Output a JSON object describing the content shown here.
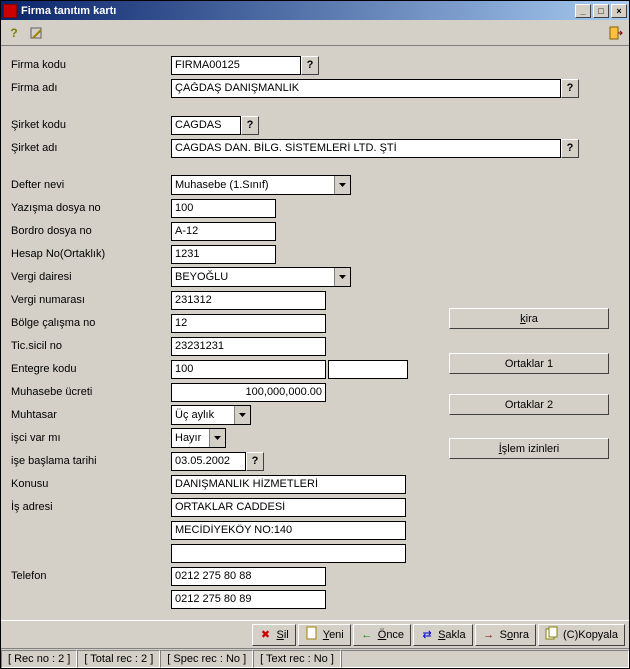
{
  "window": {
    "title": "Firma tanıtım kartı"
  },
  "labels": {
    "firma_kodu": "Firma kodu",
    "firma_adi": "Firma adı",
    "sirket_kodu": "Şirket kodu",
    "sirket_adi": "Şirket adı",
    "defter_nevi": "Defter nevi",
    "yazisma_dosya_no": "Yazışma dosya no",
    "bordro_dosya_no": "Bordro dosya no",
    "hesap_no": "Hesap No(Ortaklık)",
    "vergi_dairesi": "Vergi dairesi",
    "vergi_numarasi": "Vergi numarası",
    "bolge_calisma_no": "Bölge çalışma no",
    "tic_sicil_no": "Tic.sicil no",
    "entegre_kodu": "Entegre kodu",
    "muhasebe_ucreti": "Muhasebe ücreti",
    "muhtasar": "Muhtasar",
    "isci_var_mi": "işci var mı",
    "ise_baslama": "işe başlama tarihi",
    "konusu": "Konusu",
    "is_adresi": "İş adresi",
    "telefon": "Telefon"
  },
  "values": {
    "firma_kodu": "FIRMA00125",
    "firma_adi": "ÇAĞDAŞ DANIŞMANLIK",
    "sirket_kodu": "CAGDAS",
    "sirket_adi": "CAGDAS DAN. BİLG. SİSTEMLERİ LTD. ŞTİ",
    "defter_nevi": "Muhasebe (1.Sınıf)",
    "yazisma_dosya_no": "100",
    "bordro_dosya_no": "A-12",
    "hesap_no": "1231",
    "vergi_dairesi": "BEYOĞLU",
    "vergi_numarasi": "231312",
    "bolge_calisma_no": "12",
    "tic_sicil_no": "23231231",
    "entegre_kodu": "100",
    "muhasebe_ucreti": "100,000,000.00",
    "muhtasar": "Üç aylık",
    "isci_var_mi": "Hayır",
    "ise_baslama": "03.05.2002",
    "konusu": "DANIŞMANLIK HİZMETLERİ",
    "adres1": "ORTAKLAR CADDESİ",
    "adres2": "MECİDİYEKÖY NO:140",
    "adres3": "",
    "tel1": "0212 275 80 88",
    "tel2": "0212 275 80 89"
  },
  "sideButtons": {
    "kira": "kira",
    "ortaklar1": "Ortaklar 1",
    "ortaklar2": "Ortaklar 2",
    "islem": "İşlem izinleri"
  },
  "sideUnderline": {
    "kira": "k",
    "islem": "İ"
  },
  "bottomToolbar": {
    "sil": "Sil",
    "yeni": "Yeni",
    "once": "Önce",
    "sakla": "Sakla",
    "sonra": "Sonra",
    "kopyala": "(C)Kopyala"
  },
  "bottomUnderline": {
    "sil": "S",
    "yeni": "Y",
    "once": "Ö",
    "sakla": "S",
    "sonra": "o"
  },
  "status": {
    "rec_no": "[ Rec no :     2 ]",
    "total_rec": "[ Total rec :     2 ]",
    "spec_rec": "[ Spec rec : No ]",
    "text_rec": "[ Text rec : No ]"
  },
  "lookup": "?"
}
